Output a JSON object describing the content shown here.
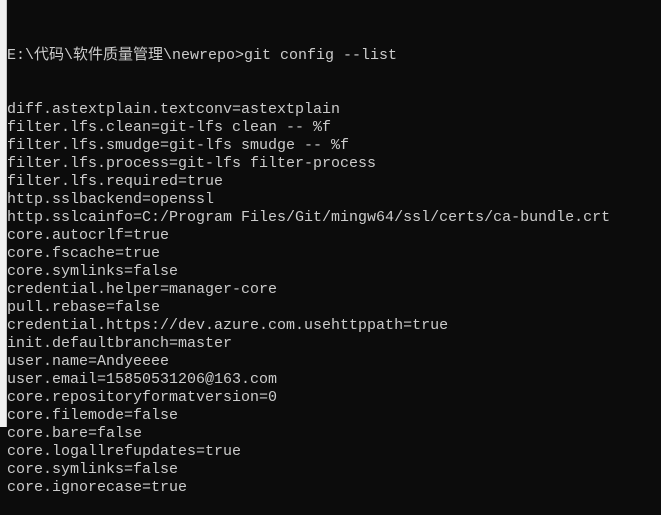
{
  "terminal": {
    "prompt": "E:\\代码\\软件质量管理\\newrepo>git config --list",
    "lines": [
      "diff.astextplain.textconv=astextplain",
      "filter.lfs.clean=git-lfs clean -- %f",
      "filter.lfs.smudge=git-lfs smudge -- %f",
      "filter.lfs.process=git-lfs filter-process",
      "filter.lfs.required=true",
      "http.sslbackend=openssl",
      "http.sslcainfo=C:/Program Files/Git/mingw64/ssl/certs/ca-bundle.crt",
      "core.autocrlf=true",
      "core.fscache=true",
      "core.symlinks=false",
      "credential.helper=manager-core",
      "pull.rebase=false",
      "credential.https://dev.azure.com.usehttppath=true",
      "init.defaultbranch=master",
      "user.name=Andyeeee",
      "user.email=15850531206@163.com",
      "core.repositoryformatversion=0",
      "core.filemode=false",
      "core.bare=false",
      "core.logallrefupdates=true",
      "core.symlinks=false",
      "core.ignorecase=true"
    ]
  }
}
